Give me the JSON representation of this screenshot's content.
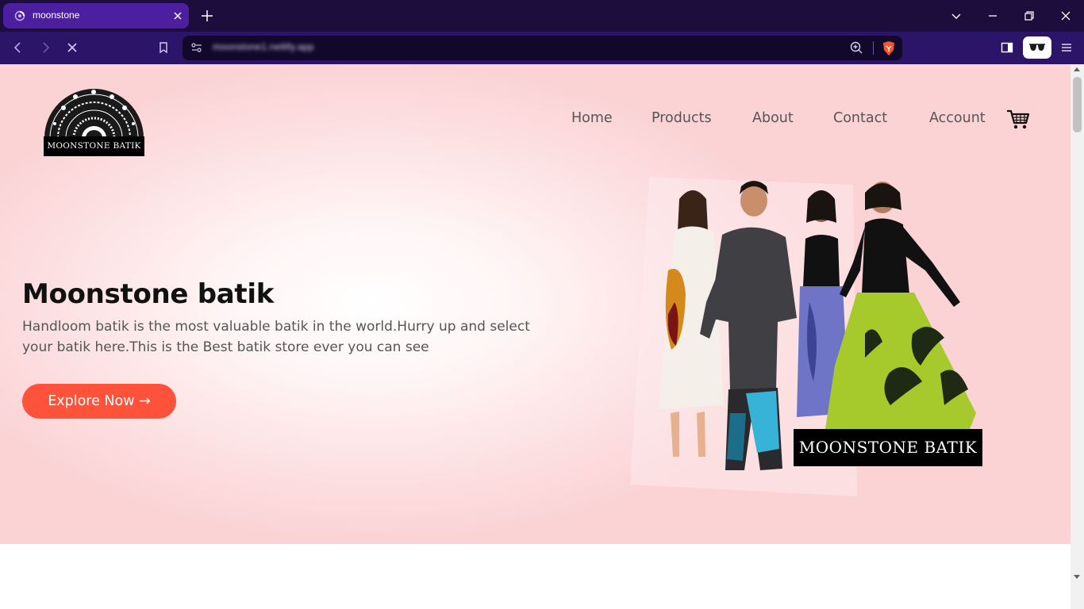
{
  "browser": {
    "tab_title": "moonstone",
    "url": "moonstone1.netlify.app",
    "accent": "#4b1fa0"
  },
  "site": {
    "logo_text": "MOONSTONE BATIK",
    "nav": [
      "Home",
      "Products",
      "About",
      "Contact",
      "Account"
    ],
    "hero": {
      "title": "Moonstone batik",
      "description": "Handloom batik is the most valuable batik in the world.Hurry up and select your batik here.This is the Best batik store ever you can see",
      "cta_label": "Explore Now →",
      "cta_color": "#ff523b",
      "image_badge": "MOONSTONE BATIK"
    }
  }
}
